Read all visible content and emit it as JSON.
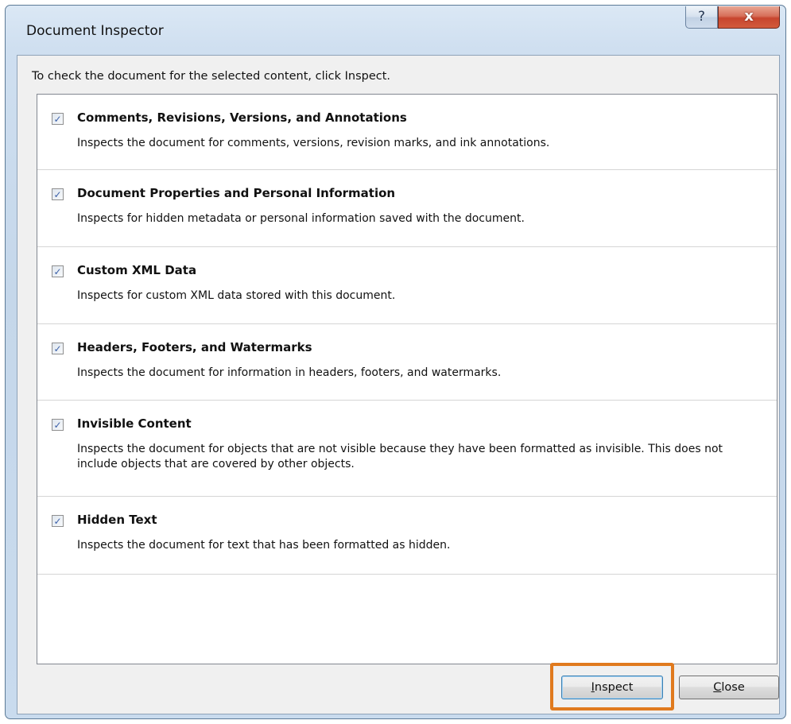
{
  "window": {
    "title": "Document Inspector",
    "help_button_label": "?",
    "close_button_label": "x"
  },
  "instruction": "To check the document for the selected content, click Inspect.",
  "items": [
    {
      "checked": true,
      "checkmark": "✓",
      "title": "Comments, Revisions, Versions, and Annotations",
      "description": "Inspects the document for comments, versions, revision marks, and ink annotations."
    },
    {
      "checked": true,
      "checkmark": "✓",
      "title": "Document Properties and Personal Information",
      "description": "Inspects for hidden metadata or personal information saved with the document."
    },
    {
      "checked": true,
      "checkmark": "✓",
      "title": "Custom XML Data",
      "description": "Inspects for custom XML data stored with this document."
    },
    {
      "checked": true,
      "checkmark": "✓",
      "title": "Headers, Footers, and Watermarks",
      "description": "Inspects the document for information in headers, footers, and watermarks."
    },
    {
      "checked": true,
      "checkmark": "✓",
      "title": "Invisible Content",
      "description": "Inspects the document for objects that are not visible because they have been formatted as invisible. This does not include objects that are covered by other objects."
    },
    {
      "checked": true,
      "checkmark": "✓",
      "title": "Hidden Text",
      "description": "Inspects the document for text that has been formatted as hidden."
    }
  ],
  "buttons": {
    "inspect": {
      "accel": "I",
      "rest": "nspect"
    },
    "close": {
      "accel": "C",
      "rest": "lose"
    }
  },
  "colors": {
    "highlight": "#e07a1e",
    "checkmark": "#3a5fa8",
    "close_button": "#c7452e"
  }
}
